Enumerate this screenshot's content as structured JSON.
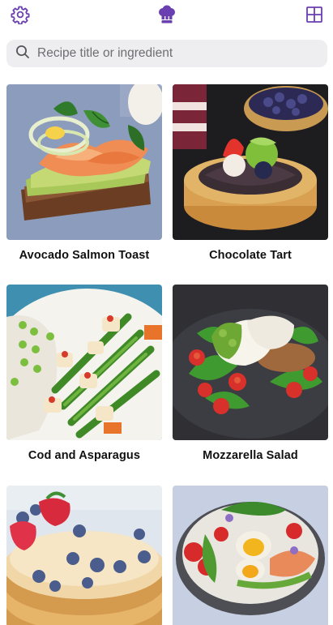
{
  "header": {
    "settings_icon": "gear-icon",
    "logo_icon": "chef-hat-icon",
    "layout_icon": "grid-view-icon",
    "accent_color": "#6a3fb0"
  },
  "search": {
    "placeholder": "Recipe title or ingredient",
    "value": ""
  },
  "recipes": [
    {
      "title": "Avocado Salmon Toast"
    },
    {
      "title": "Chocolate Tart"
    },
    {
      "title": "Cod and Asparagus"
    },
    {
      "title": "Mozzarella Salad"
    },
    {
      "title": ""
    },
    {
      "title": ""
    }
  ]
}
